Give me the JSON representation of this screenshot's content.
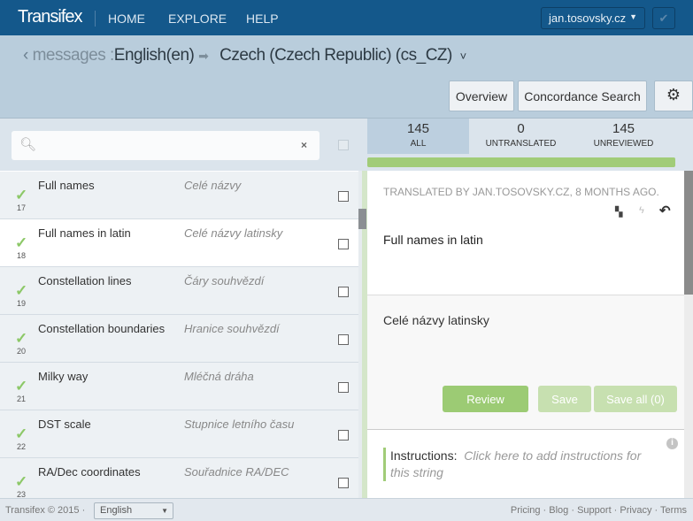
{
  "header": {
    "logo": "Transifex",
    "nav": [
      "HOME",
      "EXPLORE",
      "HELP"
    ],
    "user": "jan.tosovsky.cz"
  },
  "breadcrumb": {
    "back": "‹",
    "resource": "messages :",
    "source_lang": "English(en)",
    "arrow": "➡",
    "target_lang": "Czech (Czech Republic) (cs_CZ)",
    "dropdown": "˅"
  },
  "toolbar": {
    "overview": "Overview",
    "concordance": "Concordance Search"
  },
  "search": {
    "placeholder": "",
    "clear": "×"
  },
  "stats": [
    {
      "count": "145",
      "label": "ALL"
    },
    {
      "count": "0",
      "label": "UNTRANSLATED"
    },
    {
      "count": "145",
      "label": "UNREVIEWED"
    }
  ],
  "progress": 100,
  "strings": [
    {
      "num": "17",
      "source": "Full names",
      "translation": "Celé názvy"
    },
    {
      "num": "18",
      "source": "Full names in latin",
      "translation": "Celé názvy latinsky"
    },
    {
      "num": "19",
      "source": "Constellation lines",
      "translation": "Čáry souhvězdí"
    },
    {
      "num": "20",
      "source": "Constellation boundaries",
      "translation": "Hranice souhvězdí"
    },
    {
      "num": "21",
      "source": "Milky way",
      "translation": "Mléčná dráha"
    },
    {
      "num": "22",
      "source": "DST scale",
      "translation": "Stupnice letního času"
    },
    {
      "num": "23",
      "source": "RA/Dec coordinates",
      "translation": "Souřadnice RA/DEC"
    }
  ],
  "editor": {
    "meta": "TRANSLATED BY JAN.TOSOVSKY.CZ, 8 MONTHS AGO.",
    "source": "Full names in latin",
    "translation": "Celé názvy latinsky",
    "review": "Review",
    "save": "Save",
    "save_all": "Save all (0)",
    "instructions_label": "Instructions:",
    "instructions_placeholder": "Click here to add instructions for this string"
  },
  "footer": {
    "copyright": "Transifex © 2015 ·",
    "language": "English",
    "links": [
      "Pricing",
      "Blog",
      "Support",
      "Privacy",
      "Terms"
    ]
  }
}
